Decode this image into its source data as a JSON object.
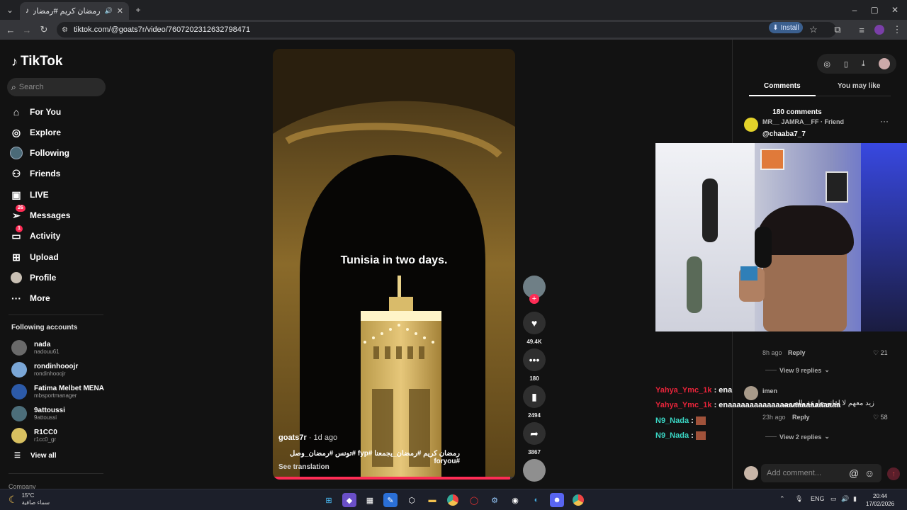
{
  "browser": {
    "tab_title": "رمضان كريم #رمضان_يجمعنا",
    "url": "tiktok.com/@goats7r/video/7607202312632798471",
    "install_label": "Install"
  },
  "sidebar": {
    "logo_text": "TikTok",
    "search_placeholder": "Search",
    "nav": [
      {
        "label": "For You",
        "icon": "home-icon"
      },
      {
        "label": "Explore",
        "icon": "compass-icon"
      },
      {
        "label": "Following",
        "icon": "following-icon"
      },
      {
        "label": "Friends",
        "icon": "friends-icon"
      },
      {
        "label": "LIVE",
        "icon": "live-icon"
      },
      {
        "label": "Messages",
        "icon": "messages-icon",
        "badge": "26"
      },
      {
        "label": "Activity",
        "icon": "activity-icon",
        "badge": "1"
      },
      {
        "label": "Upload",
        "icon": "upload-icon"
      },
      {
        "label": "Profile",
        "icon": "profile-icon"
      },
      {
        "label": "More",
        "icon": "more-icon"
      }
    ],
    "following_title": "Following accounts",
    "accounts": [
      {
        "name": "nada",
        "username": "nadouu61"
      },
      {
        "name": "rondinhooojr",
        "username": "rondinhooojr"
      },
      {
        "name": "Fatima Melbet MENA",
        "username": "mbsportmanager"
      },
      {
        "name": "9attoussi",
        "username": "9attoussi"
      },
      {
        "name": "R1CC0",
        "username": "r1cc0_gr"
      }
    ],
    "view_all": "View all",
    "company": "Company"
  },
  "video": {
    "overlay_text": "Tunisia in two days.",
    "author": "goats7r",
    "age": "· 1d ago",
    "description": "رمضان كريم #رمضان_يجمعنا #fyp #تونس #رمضان_وصل #foryou",
    "see_translation": "See translation",
    "progress": 0.98
  },
  "actions": {
    "likes": "49.4K",
    "comments": "180",
    "saves": "2494",
    "shares": "3867"
  },
  "panel": {
    "tab_comments": "Comments",
    "tab_you_may_like": "You may like",
    "comments_count": "180 comments",
    "comment1": {
      "name": "MR__ JAMRA__FF · Friend",
      "text": "@chaaba7_7"
    },
    "comment1_footer": {
      "time": "8h ago",
      "reply": "Reply",
      "likes": "21",
      "view_replies": "View 9 replies"
    },
    "comment2": {
      "name": "imen",
      "text": "زيد معهم لا لقاتو حاوعة بالعربي",
      "time": "23h ago",
      "reply": "Reply",
      "likes": "58",
      "view_replies": "View 2 replies"
    },
    "add_comment_placeholder": "Add comment..."
  },
  "chat": [
    {
      "user": "Yahya_Ymc_1k",
      "text": ": ena",
      "color": "#e8243a"
    },
    {
      "user": "Yahya_Ymc_1k",
      "text": ": enaaaaaaaaaaaaaaaaaaaaaaaaaa",
      "color": "#e8243a"
    },
    {
      "user": "N9_Nada",
      "text": ":",
      "color": "#3ad6c4"
    },
    {
      "user": "N9_Nada",
      "text": ":",
      "color": "#3ad6c4"
    }
  ],
  "taskbar": {
    "weather_temp": "15°C",
    "weather_desc": "سماء صافية",
    "lang": "ENG",
    "time": "20:44",
    "date": "17/02/2026"
  }
}
